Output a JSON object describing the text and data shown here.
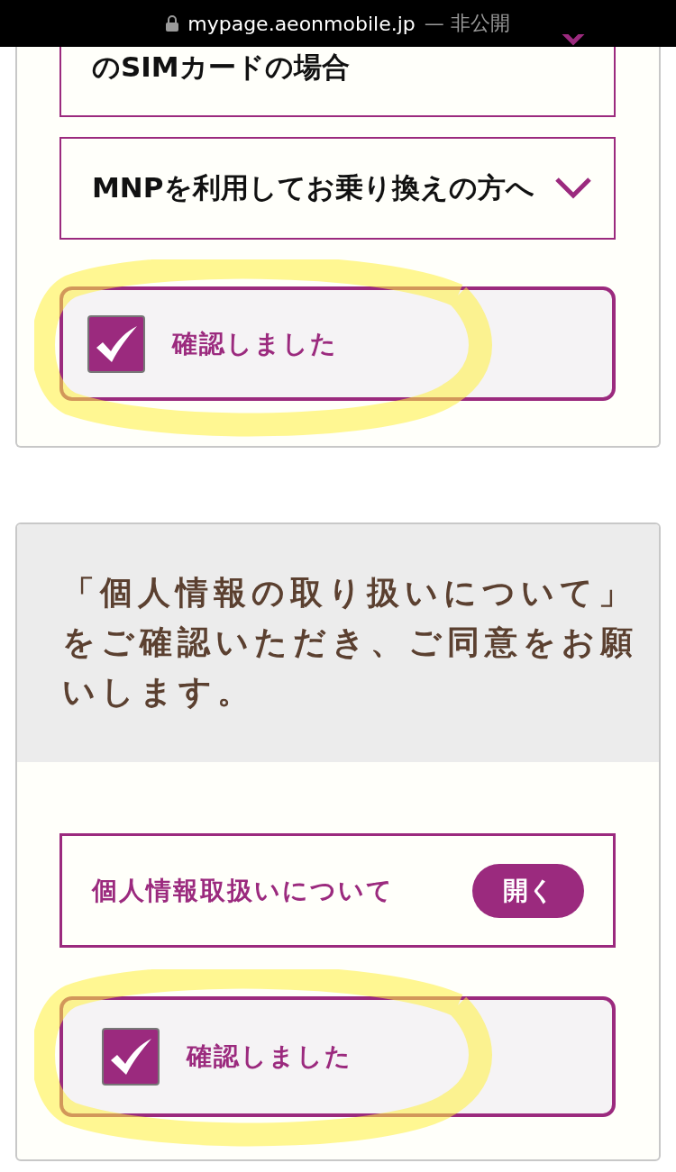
{
  "status_bar": {
    "url": "mypage.aeonmobile.jp",
    "privacy": "— 非公開"
  },
  "sim_section": {
    "accordions": [
      {
        "label": "のSIMカードの場合",
        "expanded": false
      },
      {
        "label": "MNPを利用してお乗り換えの方へ",
        "expanded": false
      }
    ],
    "confirm": {
      "label": "確認しました",
      "checked": true,
      "highlighted": true
    }
  },
  "privacy_section": {
    "heading": "「個人情報の取り扱いについて」をご確認いただき、ご同意をお願いします。",
    "document": {
      "label": "個人情報取扱いについて",
      "button": "開く"
    },
    "confirm": {
      "label": "確認しました",
      "checked": true,
      "highlighted": true
    }
  }
}
